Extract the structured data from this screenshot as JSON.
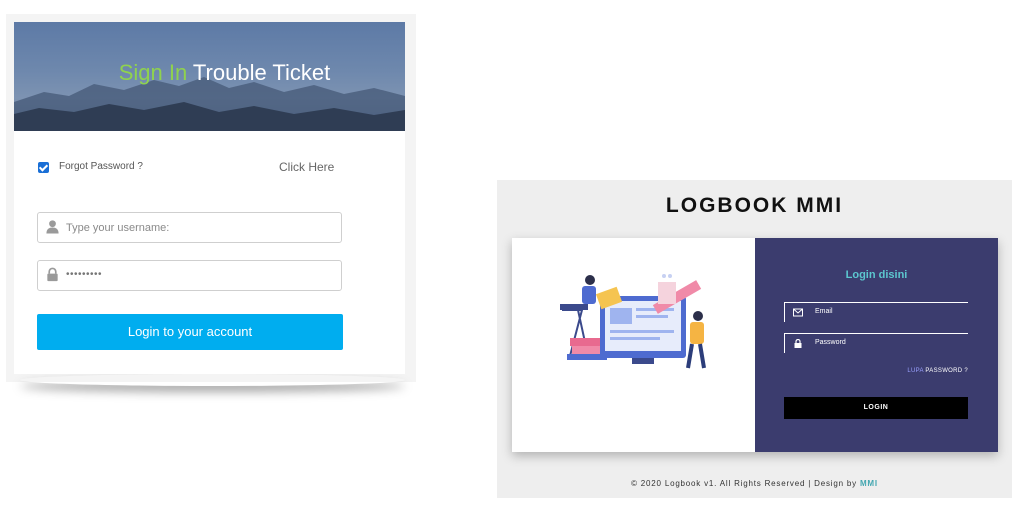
{
  "trouble_ticket": {
    "title_accent": "Sign In",
    "title_main": "Trouble Ticket",
    "forgot_label": "Forgot Password ?",
    "click_here": "Click Here",
    "username_placeholder": "Type your username:",
    "password_value": "•••••••••",
    "login_button": "Login to your account",
    "remember_checked": true,
    "colors": {
      "accent": "#8fd24e",
      "button": "#00adef",
      "checkbox": "#1a6fd6"
    }
  },
  "logbook": {
    "title": "LOGBOOK MMI",
    "form_title": "Login disini",
    "email_placeholder": "Email",
    "password_placeholder": "Password",
    "forgot_prefix": "LUPA",
    "forgot_rest": " PASSWORD ?",
    "login_button": "LOGIN",
    "footer_text": "© 2020 Logbook v1. All Rights Reserved | Design by ",
    "footer_brand": "MMI",
    "colors": {
      "form_bg": "#3b3c6e",
      "form_title": "#5cc7cf",
      "brand": "#42a6b0"
    }
  }
}
